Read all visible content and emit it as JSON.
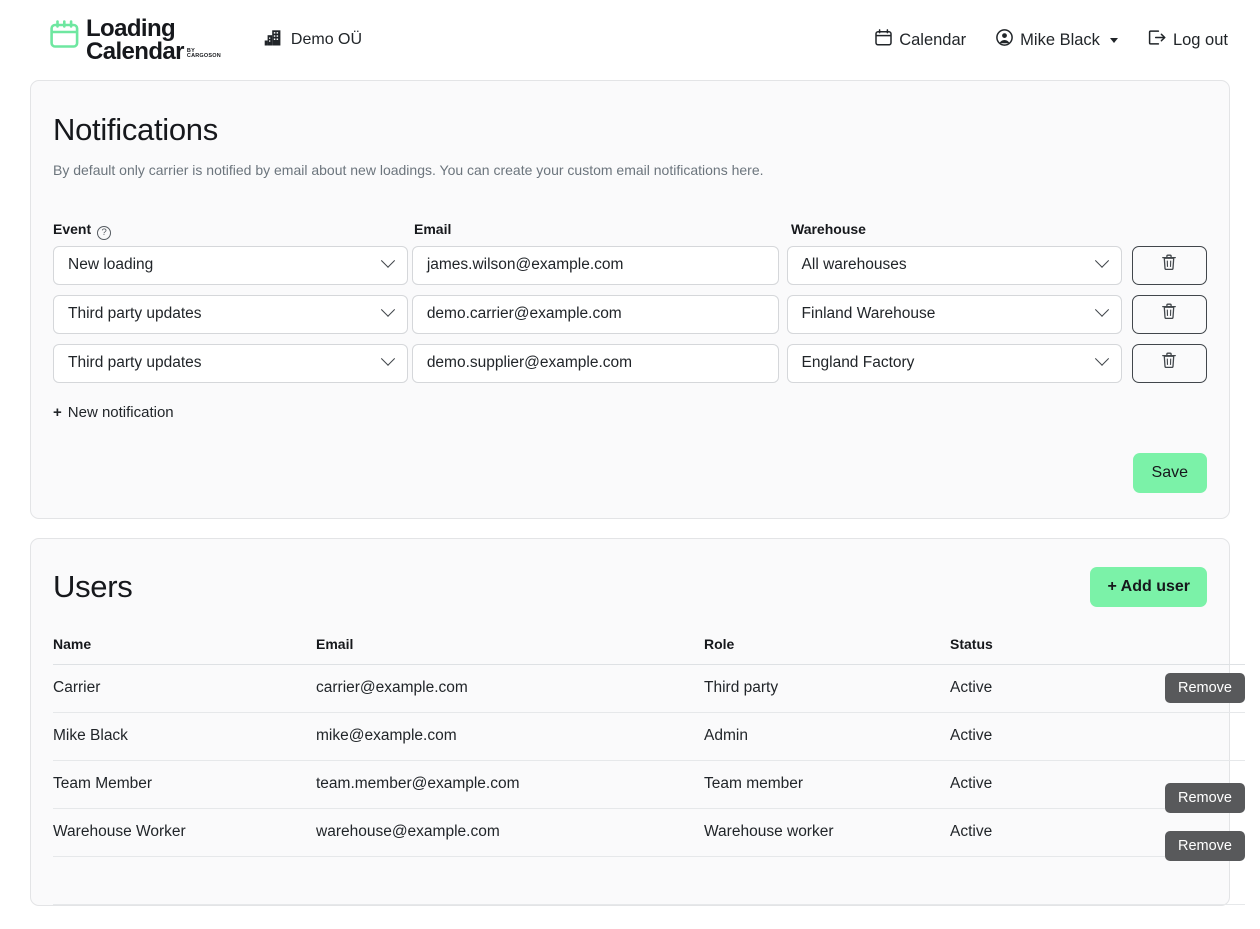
{
  "brand": {
    "line1": "Loading",
    "line2": "Calendar",
    "by": "BY",
    "company": "CARGOSON",
    "icon": "calendar-icon",
    "accent": "#6ee7a0"
  },
  "org": {
    "name": "Demo OÜ",
    "icon": "building-icon"
  },
  "nav": {
    "calendar": "Calendar",
    "user": "Mike Black",
    "logout": "Log out"
  },
  "notifications": {
    "title": "Notifications",
    "subtitle": "By default only carrier is notified by email about new loadings. You can create your custom email notifications here.",
    "columns": {
      "event": "Event",
      "email": "Email",
      "warehouse": "Warehouse",
      "help_icon_glyph": "?"
    },
    "rows": [
      {
        "event": "New loading",
        "email": "james.wilson@example.com",
        "warehouse": "All warehouses",
        "delete_icon": "trash-icon"
      },
      {
        "event": "Third party updates",
        "email": "demo.carrier@example.com",
        "warehouse": "Finland Warehouse",
        "delete_icon": "trash-icon"
      },
      {
        "event": "Third party updates",
        "email": "demo.supplier@example.com",
        "warehouse": "England Factory",
        "delete_icon": "trash-icon"
      }
    ],
    "new_notification": "New notification",
    "new_notification_plus": "+",
    "save_label": "Save",
    "save_color": "#7bf2a8"
  },
  "users": {
    "title": "Users",
    "add_user_label": "+ Add user",
    "add_user_color": "#7bf2a8",
    "columns": [
      "Name",
      "Email",
      "Role",
      "Status"
    ],
    "rows": [
      {
        "name": "Carrier",
        "email": "carrier@example.com",
        "role": "Third party",
        "status": "Active",
        "action": "Remove"
      },
      {
        "name": "Mike Black",
        "email": "mike@example.com",
        "role": "Admin",
        "status": "Active",
        "action": ""
      },
      {
        "name": "Team Member",
        "email": "team.member@example.com",
        "role": "Team member",
        "status": "Active",
        "action": "Remove"
      },
      {
        "name": "Warehouse Worker",
        "email": "warehouse@example.com",
        "role": "Warehouse worker",
        "status": "Active",
        "action": "Remove"
      }
    ]
  }
}
